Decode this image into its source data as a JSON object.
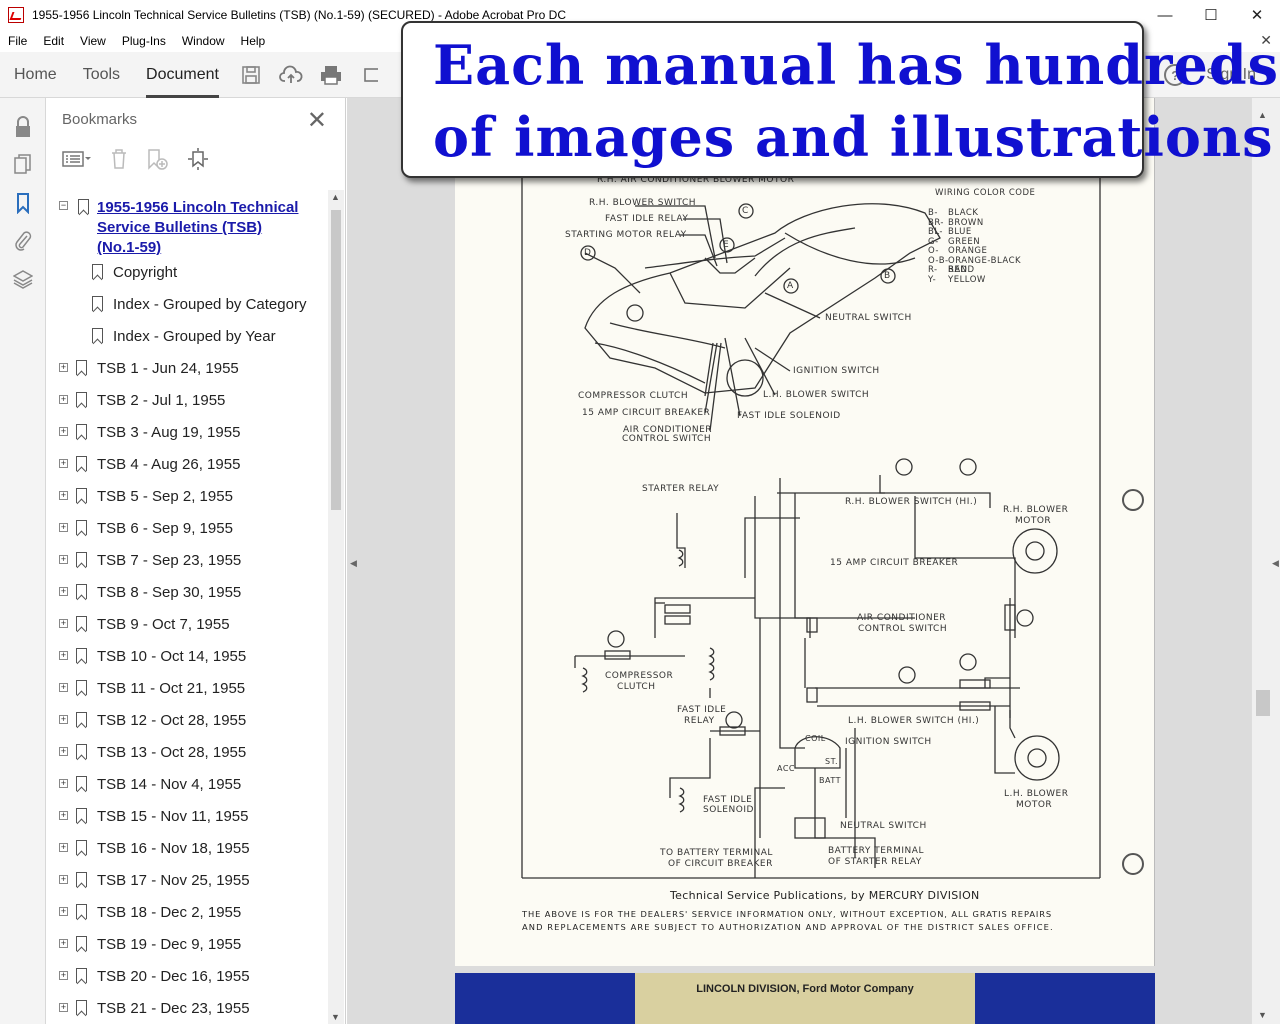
{
  "window": {
    "title": "1955-1956 Lincoln Technical Service Bulletins (TSB) (No.1-59) (SECURED) - Adobe Acrobat Pro DC",
    "controls": [
      "—",
      "☐",
      "✕"
    ]
  },
  "menu": [
    "File",
    "Edit",
    "View",
    "Plug-Ins",
    "Window",
    "Help"
  ],
  "toolbar": {
    "tabs": [
      "Home",
      "Tools",
      "Document"
    ],
    "active_tab": "Document",
    "sign_in": "Sign In",
    "help": "?"
  },
  "bookmarks_panel": {
    "title": "Bookmarks",
    "root": "1955-1956 Lincoln Technical Service Bulletins (TSB) (No.1-59)",
    "children": [
      "Copyright",
      "Index - Grouped by Category",
      "Index - Grouped by Year"
    ],
    "items": [
      "TSB 1 - Jun 24, 1955",
      "TSB 2 - Jul 1, 1955",
      "TSB 3 - Aug 19, 1955",
      "TSB 4 - Aug 26, 1955",
      "TSB 5 - Sep 2, 1955",
      "TSB 6 - Sep 9, 1955",
      "TSB 7 - Sep 23, 1955",
      "TSB 8 - Sep 30, 1955",
      "TSB 9 - Oct 7, 1955",
      "TSB 10 - Oct 14, 1955",
      "TSB 11 - Oct 21, 1955",
      "TSB 12 - Oct 28, 1955",
      "TSB 13 - Oct 28, 1955",
      "TSB 14 - Nov 4, 1955",
      "TSB 15 - Nov 11, 1955",
      "TSB 16 - Nov 18, 1955",
      "TSB 17 - Nov 25, 1955",
      "TSB 18 - Dec 2, 1955",
      "TSB 19 - Dec 9, 1955",
      "TSB 20 - Dec 16, 1955",
      "TSB 21 - Dec 23, 1955"
    ]
  },
  "overlay": {
    "line1": "Each manual has hundreds",
    "line2": "of images and illustrations"
  },
  "document": {
    "top_labels": {
      "rh_ac_motor": "R.H. AIR CONDITIONER BLOWER MOTOR",
      "rh_blower_switch": "R.H. BLOWER SWITCH",
      "fast_idle_relay": "FAST IDLE RELAY",
      "starting_motor_relay": "STARTING MOTOR RELAY",
      "neutral_switch": "NEUTRAL SWITCH",
      "ignition_switch": "IGNITION SWITCH",
      "lh_blower_switch": "L.H. BLOWER SWITCH",
      "fast_idle_solenoid": "FAST IDLE SOLENOID",
      "compressor_clutch": "COMPRESSOR CLUTCH",
      "breaker": "15 AMP CIRCUIT BREAKER",
      "ac_control_1": "AIR CONDITIONER",
      "ac_control_2": "CONTROL SWITCH"
    },
    "color_code": {
      "title": "WIRING COLOR CODE",
      "codes": [
        "B-",
        "BR-",
        "BL-",
        "G-",
        "O-",
        "O-B-",
        "R-",
        "Y-"
      ],
      "names": [
        "BLACK",
        "BROWN",
        "BLUE",
        "GREEN",
        "ORANGE",
        "ORANGE-BLACK BAND",
        "RED",
        "YELLOW"
      ]
    },
    "schematic": {
      "starter_relay": "STARTER RELAY",
      "rh_blower_switch_hi": "R.H. BLOWER SWITCH (HI.)",
      "rh_blower_motor_1": "R.H. BLOWER",
      "rh_blower_motor_2": "MOTOR",
      "breaker": "15 AMP CIRCUIT BREAKER",
      "ac_control_1": "AIR CONDITIONER",
      "ac_control_2": "CONTROL SWITCH",
      "compressor_1": "COMPRESSOR",
      "compressor_2": "CLUTCH",
      "fast_idle_relay_1": "FAST IDLE",
      "fast_idle_relay_2": "RELAY",
      "lh_blower_switch_hi": "L.H. BLOWER SWITCH (HI.)",
      "ignition_switch": "IGNITION SWITCH",
      "coil": "COIL",
      "acc": "ACC",
      "st": "ST.",
      "batt": "BATT",
      "fast_idle_solenoid_1": "FAST IDLE",
      "fast_idle_solenoid_2": "SOLENOID",
      "neutral_switch": "NEUTRAL SWITCH",
      "lh_blower_motor_1": "L.H. BLOWER",
      "lh_blower_motor_2": "MOTOR",
      "battery_terminal_breaker_1": "TO BATTERY TERMINAL",
      "battery_terminal_breaker_2": "OF CIRCUIT BREAKER",
      "battery_terminal_relay_1": "BATTERY TERMINAL",
      "battery_terminal_relay_2": "OF STARTER RELAY"
    },
    "footer": "Technical Service Publications, by MERCURY DIVISION",
    "disclaimer_1": "THE ABOVE IS FOR THE DEALERS' SERVICE INFORMATION ONLY, WITHOUT EXCEPTION, ALL GRATIS REPAIRS",
    "disclaimer_2": "AND REPLACEMENTS ARE SUBJECT TO AUTHORIZATION AND APPROVAL OF THE DISTRICT SALES OFFICE.",
    "next_page_header": "LINCOLN DIVISION, Ford Motor Company"
  }
}
